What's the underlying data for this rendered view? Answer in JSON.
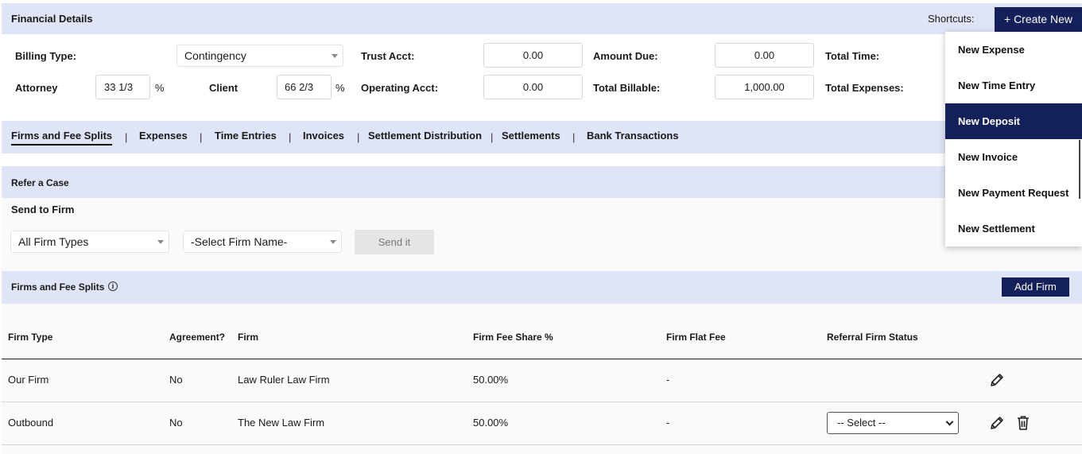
{
  "header": {
    "title": "Financial Details",
    "shortcuts_label": "Shortcuts:",
    "create_new_label": "+ Create New"
  },
  "details": {
    "billing_type_label": "Billing Type:",
    "billing_type_value": "Contingency",
    "attorney_label": "Attorney",
    "attorney_value": "33 1/3",
    "attorney_pct": "%",
    "client_label": "Client",
    "client_value": "66 2/3",
    "client_pct": "%",
    "trust_acct_label": "Trust Acct:",
    "trust_acct_value": "0.00",
    "operating_acct_label": "Operating Acct:",
    "operating_acct_value": "0.00",
    "amount_due_label": "Amount Due:",
    "amount_due_value": "0.00",
    "total_billable_label": "Total Billable:",
    "total_billable_value": "1,000.00",
    "total_time_label": "Total Time:",
    "total_expenses_label": "Total Expenses:"
  },
  "tabs": [
    {
      "label": "Firms and Fee Splits"
    },
    {
      "label": "Expenses"
    },
    {
      "label": "Time Entries"
    },
    {
      "label": "Invoices"
    },
    {
      "label": "Settlement Distribution"
    },
    {
      "label": "Settlements"
    },
    {
      "label": "Bank Transactions"
    }
  ],
  "tab_separator": "|",
  "refer": {
    "title": "Refer a Case",
    "send_to_firm_label": "Send to Firm",
    "firm_types_value": "All Firm Types",
    "firm_name_value": "-Select Firm Name-",
    "send_button": "Send it"
  },
  "fee_splits": {
    "title": "Firms and Fee Splits",
    "info_glyph": "i",
    "add_firm_button": "Add Firm",
    "columns": [
      "Firm Type",
      "Agreement?",
      "Firm",
      "Firm Fee Share %",
      "Firm Flat Fee",
      "Referral Firm Status"
    ],
    "rows": [
      {
        "firm_type": "Our Firm",
        "agreement": "No",
        "firm": "Law Ruler Law Firm",
        "share": "50.00%",
        "flat_fee": "-",
        "status": ""
      },
      {
        "firm_type": "Outbound",
        "agreement": "No",
        "firm": "The New Law Firm",
        "share": "50.00%",
        "flat_fee": "-",
        "status": "-- Select --"
      }
    ]
  },
  "menu": {
    "items": [
      {
        "label": "New Expense"
      },
      {
        "label": "New Time Entry"
      },
      {
        "label": "New Deposit",
        "active": true
      },
      {
        "label": "New Invoice"
      },
      {
        "label": "New Payment Request"
      },
      {
        "label": "New Settlement"
      }
    ]
  },
  "colors": {
    "brand_navy": "#14205a",
    "band": "#dfe4f6"
  }
}
